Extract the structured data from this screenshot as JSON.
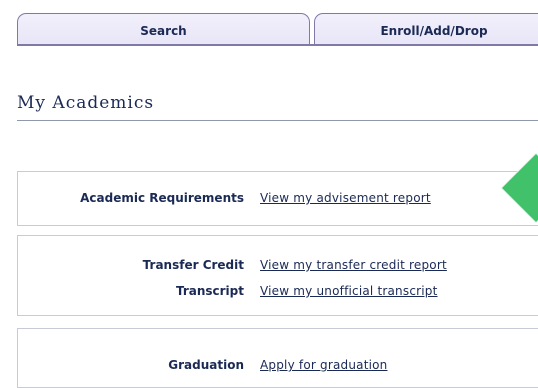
{
  "tabs": {
    "search": "Search",
    "enroll": "Enroll/Add/Drop"
  },
  "page": {
    "title": "My Academics"
  },
  "sections": {
    "academic_requirements": {
      "label": "Academic Requirements",
      "link": "View my advisement report"
    },
    "transfer_credit": {
      "label": "Transfer Credit",
      "link": "View my transfer credit report"
    },
    "transcript": {
      "label": "Transcript",
      "link": "View my unofficial transcript"
    },
    "graduation": {
      "label": "Graduation",
      "link": "Apply for graduation"
    }
  },
  "colors": {
    "tab_fill": "#ece9f8",
    "text": "#1b2a55",
    "accent_diamond": "#41c16a"
  }
}
